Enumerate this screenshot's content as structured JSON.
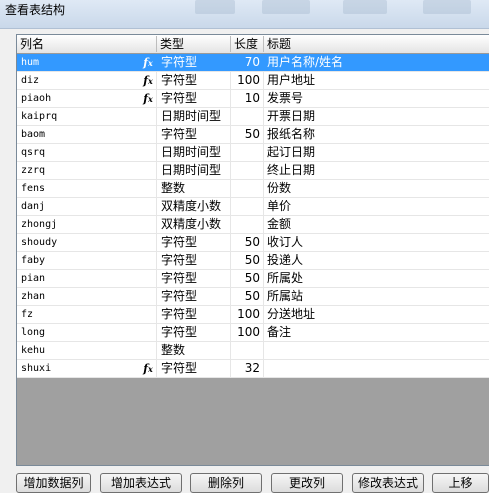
{
  "window": {
    "title": "查看表结构"
  },
  "columns": {
    "name": "列名",
    "type": "类型",
    "length": "长度",
    "title": "标题"
  },
  "rows": [
    {
      "name": "hum",
      "fx": "fx",
      "type": "字符型",
      "length": "70",
      "title": "用户名称/姓名",
      "selected": true
    },
    {
      "name": "diz",
      "fx": "fx",
      "type": "字符型",
      "length": "100",
      "title": "用户地址"
    },
    {
      "name": "piaoh",
      "fx": "fx",
      "type": "字符型",
      "length": "10",
      "title": "发票号"
    },
    {
      "name": "kaiprq",
      "fx": "",
      "type": "日期时间型",
      "length": "",
      "title": "开票日期"
    },
    {
      "name": "baom",
      "fx": "",
      "type": "字符型",
      "length": "50",
      "title": "报纸名称"
    },
    {
      "name": "qsrq",
      "fx": "",
      "type": "日期时间型",
      "length": "",
      "title": "起订日期"
    },
    {
      "name": "zzrq",
      "fx": "",
      "type": "日期时间型",
      "length": "",
      "title": "终止日期"
    },
    {
      "name": "fens",
      "fx": "",
      "type": "整数",
      "length": "",
      "title": "份数"
    },
    {
      "name": "danj",
      "fx": "",
      "type": "双精度小数",
      "length": "",
      "title": "单价"
    },
    {
      "name": "zhongj",
      "fx": "",
      "type": "双精度小数",
      "length": "",
      "title": "金额"
    },
    {
      "name": "shoudy",
      "fx": "",
      "type": "字符型",
      "length": "50",
      "title": "收订人"
    },
    {
      "name": "faby",
      "fx": "",
      "type": "字符型",
      "length": "50",
      "title": "投递人"
    },
    {
      "name": "pian",
      "fx": "",
      "type": "字符型",
      "length": "50",
      "title": "所属处"
    },
    {
      "name": "zhan",
      "fx": "",
      "type": "字符型",
      "length": "50",
      "title": "所属站"
    },
    {
      "name": "fz",
      "fx": "",
      "type": "字符型",
      "length": "100",
      "title": "分送地址"
    },
    {
      "name": "long",
      "fx": "",
      "type": "字符型",
      "length": "100",
      "title": "备注"
    },
    {
      "name": "kehu",
      "fx": "",
      "type": "整数",
      "length": "",
      "title": ""
    },
    {
      "name": "shuxi",
      "fx": "fx",
      "type": "字符型",
      "length": "32",
      "title": ""
    }
  ],
  "buttons": {
    "add_data_col": "增加数据列",
    "add_expr": "增加表达式",
    "delete_col": "删除列",
    "modify_col": "更改列",
    "modify_expr": "修改表达式",
    "move_up": "上移"
  }
}
